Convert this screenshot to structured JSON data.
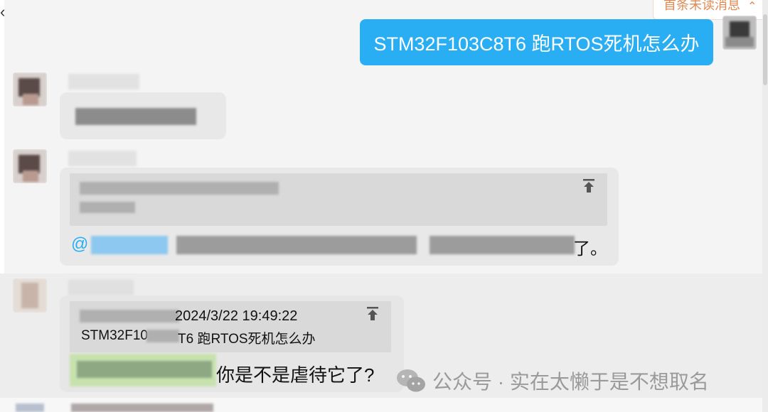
{
  "header": {
    "unread_label": "首条未读消息",
    "unread_chevron": "⌃"
  },
  "messages": {
    "outgoing_text": "STM32F103C8T6 跑RTOS死机怎么办",
    "reply_suffix": "了。",
    "at_sign": "@",
    "quote_timestamp": "2024/3/22 19:49:22",
    "quote_text_part1": "STM32F10",
    "quote_text_part2": "T6 跑RTOS死机怎么办",
    "last_reply_text": "你是不是虐待它了?"
  },
  "watermark": {
    "text": "公众号 · 实在太懒于是不想取名"
  },
  "colors": {
    "outgoing_bubble": "#2aaef3",
    "incoming_bubble": "#e8e8e8",
    "quote_box": "#d9d9d9",
    "unread_text": "#e08a55",
    "mention_blue": "#2aaef3"
  }
}
